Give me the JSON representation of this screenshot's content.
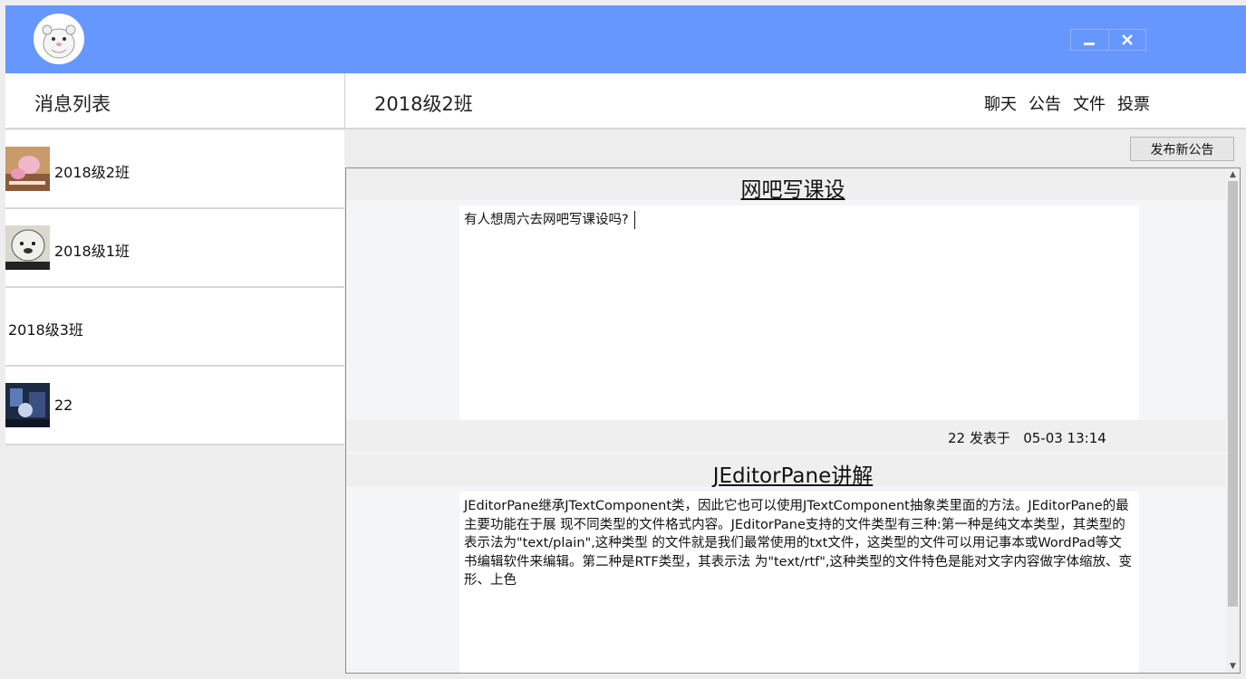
{
  "window": {
    "minimize_icon": "minimize-icon",
    "close_icon": "close-icon",
    "titlebar_color": "#6697ff"
  },
  "sidebar": {
    "title": "消息列表",
    "items": [
      {
        "name": "2018级2班",
        "has_avatar": true
      },
      {
        "name": "2018级1班",
        "has_avatar": true
      },
      {
        "name": "2018级3班",
        "has_avatar": false
      },
      {
        "name": "22",
        "has_avatar": true
      }
    ]
  },
  "main": {
    "group_title": "2018级2班",
    "nav": [
      "聊天",
      "公告",
      "文件",
      "投票"
    ],
    "publish_button": "发布新公告",
    "notices": [
      {
        "title": "网吧写课设",
        "body": "有人想周六去网吧写课设吗?",
        "author": "22",
        "posted_label": "发表于",
        "time": "05-03 13:14"
      },
      {
        "title": "JEditorPane讲解",
        "body": "JEditorPane继承JTextComponent类，因此它也可以使用JTextComponent抽象类里面的方法。JEditorPane的最主要功能在于展 现不同类型的文件格式内容。JEditorPane支持的文件类型有三种:第一种是纯文本类型，其类型的表示法为\"text/plain\",这种类型 的文件就是我们最常使用的txt文件，这类型的文件可以用记事本或WordPad等文书编辑软件来编辑。第二种是RTF类型，其表示法 为\"text/rtf\",这种类型的文件特色是能对文字内容做字体缩放、变形、上色"
      }
    ]
  }
}
